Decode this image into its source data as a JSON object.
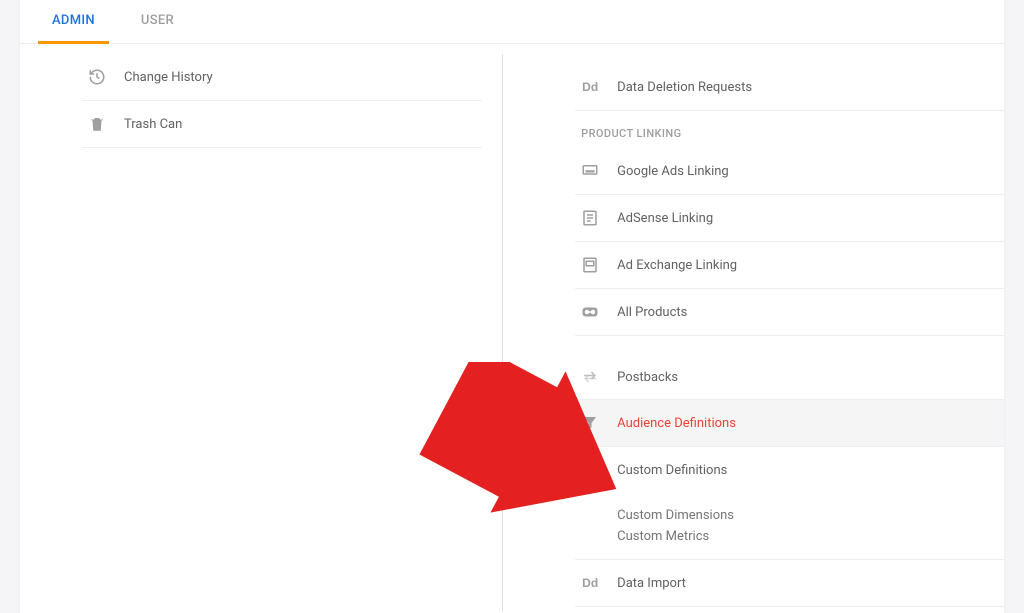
{
  "tabs": {
    "admin": "ADMIN",
    "user": "USER"
  },
  "left": {
    "items": [
      {
        "label": "Change History",
        "icon": "history"
      },
      {
        "label": "Trash Can",
        "icon": "trash"
      }
    ]
  },
  "right": {
    "top": {
      "label": "Data Deletion Requests",
      "icon": "dd"
    },
    "product_linking_header": "PRODUCT LINKING",
    "product_linking": [
      {
        "label": "Google Ads Linking",
        "icon": "billboard"
      },
      {
        "label": "AdSense Linking",
        "icon": "page-list"
      },
      {
        "label": "Ad Exchange Linking",
        "icon": "page-box"
      },
      {
        "label": "All Products",
        "icon": "link"
      }
    ],
    "postbacks": {
      "label": "Postbacks",
      "icon": "swap"
    },
    "audience": {
      "label": "Audience Definitions",
      "icon": "filter"
    },
    "custom_definitions": {
      "label": "Custom Definitions",
      "icon": "dd"
    },
    "custom_sub": {
      "dimensions": "Custom Dimensions",
      "metrics": "Custom Metrics"
    },
    "data_import": {
      "label": "Data Import",
      "icon": "dd"
    }
  }
}
